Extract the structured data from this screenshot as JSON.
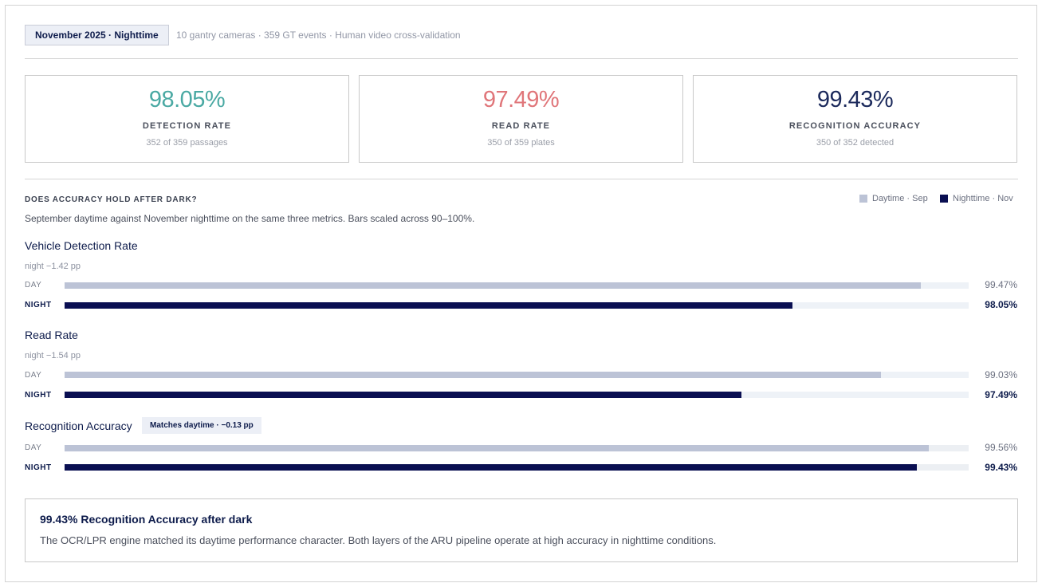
{
  "header": {
    "period": "November 2025 · Nighttime",
    "meta": "10 gantry cameras · 359 GT events · Human video cross-validation"
  },
  "kpis": [
    {
      "value": "98.05%",
      "label": "DETECTION RATE",
      "sub": "352 of 359 passages",
      "color": "#4aa9a3"
    },
    {
      "value": "97.49%",
      "label": "READ RATE",
      "sub": "350 of 359 plates",
      "color": "#e0767a"
    },
    {
      "value": "99.43%",
      "label": "RECOGNITION ACCURACY",
      "sub": "350 of 352 detected",
      "color": "#1c2a5c"
    }
  ],
  "section": {
    "title": "DOES ACCURACY HOLD AFTER DARK?",
    "description": "September daytime against November nighttime on the same three metrics. Bars scaled across 90–100%.",
    "row_labels": {
      "day": "DAY",
      "night": "NIGHT"
    }
  },
  "legend": [
    {
      "label": "Daytime · Sep",
      "color": "#bcc3d6"
    },
    {
      "label": "Nighttime · Nov",
      "color": "#0a0f52"
    }
  ],
  "chart_data": {
    "type": "bar",
    "orientation": "horizontal",
    "xlim": [
      90,
      100
    ],
    "series": [
      {
        "name": "Daytime · Sep",
        "color": "#bcc3d6"
      },
      {
        "name": "Nighttime · Nov",
        "color": "#0a0f52"
      }
    ],
    "metrics": [
      {
        "name": "Vehicle Detection Rate",
        "delta": "night −1.42 pp",
        "badge": "",
        "day": 99.47,
        "night": 98.05,
        "day_label": "99.47%",
        "night_label": "98.05%"
      },
      {
        "name": "Read Rate",
        "delta": "night −1.54 pp",
        "badge": "",
        "day": 99.03,
        "night": 97.49,
        "day_label": "99.03%",
        "night_label": "97.49%"
      },
      {
        "name": "Recognition Accuracy",
        "delta": "",
        "badge": "Matches daytime · −0.13 pp",
        "day": 99.56,
        "night": 99.43,
        "day_label": "99.56%",
        "night_label": "99.43%"
      }
    ]
  },
  "callout": {
    "title": "99.43% Recognition Accuracy after dark",
    "body": "The OCR/LPR engine matched its daytime performance character. Both layers of the ARU pipeline operate at high accuracy in nighttime conditions."
  }
}
